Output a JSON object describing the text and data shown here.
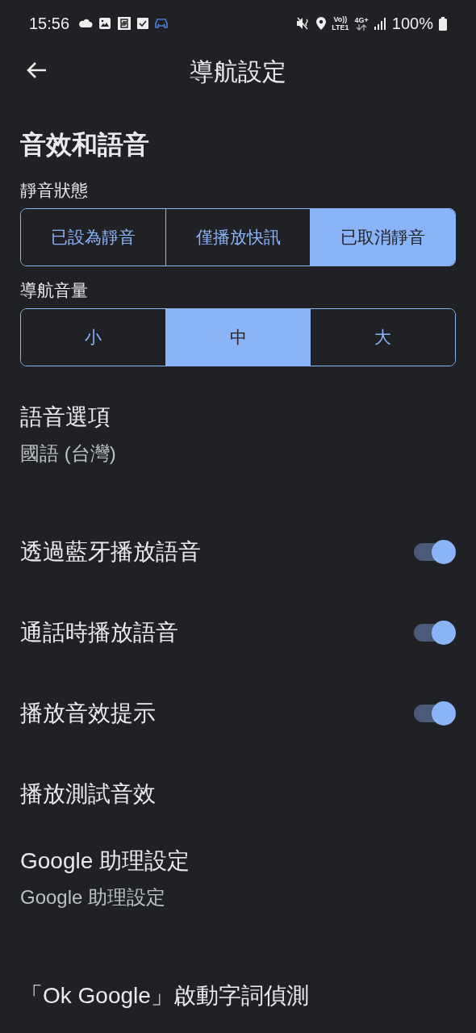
{
  "status_bar": {
    "time": "15:56",
    "battery": "100%",
    "network_top": "Vo))",
    "network_bottom": "LTE1",
    "data_type": "4G+"
  },
  "app_bar": {
    "title": "導航設定"
  },
  "section": {
    "title": "音效和語音"
  },
  "segment_groups": [
    {
      "label": "靜音狀態",
      "options": [
        {
          "label": "已設為靜音",
          "selected": false
        },
        {
          "label": "僅播放快訊",
          "selected": false
        },
        {
          "label": "已取消靜音",
          "selected": true
        }
      ]
    },
    {
      "label": "導航音量",
      "options": [
        {
          "label": "小",
          "selected": false
        },
        {
          "label": "中",
          "selected": true
        },
        {
          "label": "大",
          "selected": false
        }
      ]
    }
  ],
  "settings": [
    {
      "kind": "detail",
      "title": "語音選項",
      "subtitle": "國語 (台灣)"
    },
    {
      "kind": "toggle",
      "title": "透過藍牙播放語音",
      "on": true
    },
    {
      "kind": "toggle",
      "title": "通話時播放語音",
      "on": true
    },
    {
      "kind": "toggle",
      "title": "播放音效提示",
      "on": true
    },
    {
      "kind": "plain",
      "title": "播放測試音效"
    },
    {
      "kind": "detail",
      "title": "Google 助理設定",
      "subtitle": "Google 助理設定"
    },
    {
      "kind": "plain",
      "title": "「Ok Google」啟動字詞偵測"
    }
  ]
}
